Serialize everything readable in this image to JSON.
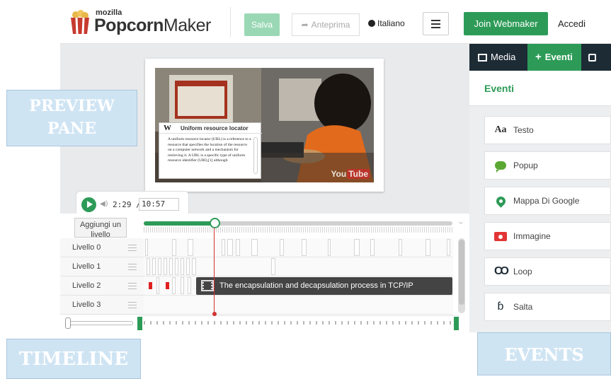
{
  "header": {
    "logo_small": "mozilla",
    "logo_bold": "Popcorn",
    "logo_rest": "Maker",
    "save_label": "Salva",
    "preview_label": "Anteprima",
    "language_label": "Italiano",
    "join_label": "Join Webmaker",
    "login_label": "Accedi"
  },
  "annotations": {
    "preview": "PREVIEW PANE",
    "timeline": "TIMELINE",
    "events": "EVENTS"
  },
  "video": {
    "wiki_title": "Uniform resource locator",
    "wiki_text": "A uniform resource locator (URL) is a reference to a resource that specifies the location of the resource on a computer network and a mechanism for retrieving it. A URL is a specific type of uniform resource identifier (URI),[1] although",
    "youtube_you": "You",
    "youtube_tube": "Tube"
  },
  "controls": {
    "current_time": "2:29 /",
    "total_time": "10:57"
  },
  "timeline": {
    "add_layer_label": "Aggiungi un livello",
    "layers": [
      "Livello 0",
      "Livello 1",
      "Livello 2",
      "Livello 3"
    ],
    "event_label": "The encapsulation and decapsulation process in TCP/IP",
    "progress": 0.23
  },
  "panel": {
    "tabs": [
      "Media",
      "Eventi",
      ""
    ],
    "active_tab": "Eventi",
    "title": "Eventi",
    "items": [
      {
        "label": "Testo",
        "icon": "text-icon"
      },
      {
        "label": "Popup",
        "icon": "speech-bubble-icon"
      },
      {
        "label": "Mappa Di Google",
        "icon": "map-pin-icon"
      },
      {
        "label": "Immagine",
        "icon": "camera-icon"
      },
      {
        "label": "Loop",
        "icon": "loop-icon"
      },
      {
        "label": "Salta",
        "icon": "skip-icon"
      }
    ]
  },
  "colors": {
    "accent": "#2d9b57",
    "dark": "#1d2b35",
    "playhead": "#d23030"
  }
}
